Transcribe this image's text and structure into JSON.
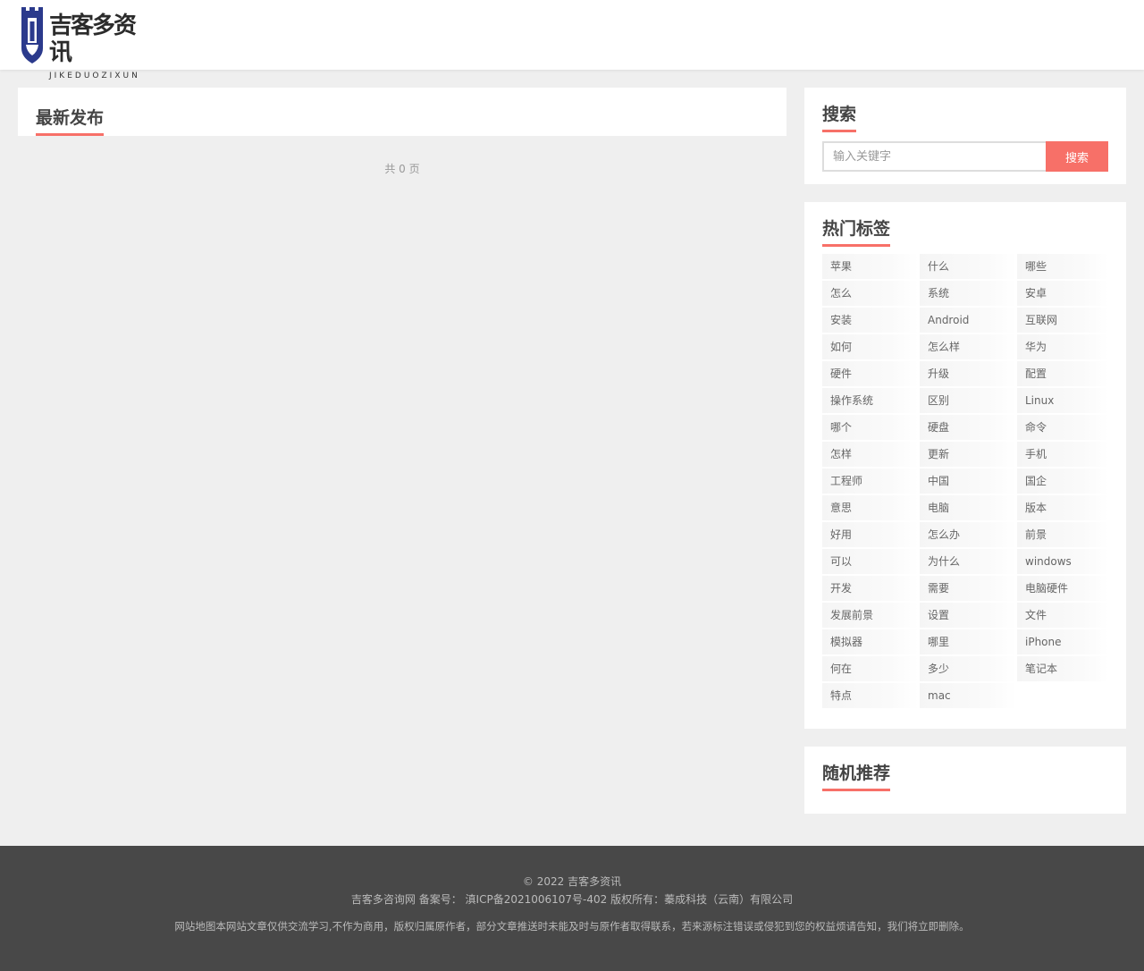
{
  "header": {
    "logo_cn": "吉客多资讯",
    "logo_en": "JIKEDUOZIXUN"
  },
  "main": {
    "section_title": "最新发布",
    "pager_text": "共 0 页"
  },
  "sidebar": {
    "search": {
      "title": "搜索",
      "placeholder": "输入关键字",
      "button_label": "搜索"
    },
    "tags": {
      "title": "热门标签",
      "items": [
        "苹果",
        "什么",
        "哪些",
        "怎么",
        "系统",
        "安卓",
        "安装",
        "Android",
        "互联网",
        "如何",
        "怎么样",
        "华为",
        "硬件",
        "升级",
        "配置",
        "操作系统",
        "区别",
        "Linux",
        "哪个",
        "硬盘",
        "命令",
        "怎样",
        "更新",
        "手机",
        "工程师",
        "中国",
        "国企",
        "意思",
        "电脑",
        "版本",
        "好用",
        "怎么办",
        "前景",
        "可以",
        "为什么",
        "windows",
        "开发",
        "需要",
        "电脑硬件",
        "发展前景",
        "设置",
        "文件",
        "模拟器",
        "哪里",
        "iPhone",
        "何在",
        "多少",
        "笔记本",
        "特点",
        "mac"
      ]
    },
    "random": {
      "title": "随机推荐"
    }
  },
  "footer": {
    "copyright": "© 2022 吉客多资讯",
    "icp": "吉客多咨询网 备案号： 滇ICP备2021006107号-402 版权所有：蓁成科技（云南）有限公司",
    "disclaimer": "网站地图本网站文章仅供交流学习,不作为商用，版权归属原作者，部分文章推送时未能及时与原作者取得联系，若来源标注错误或侵犯到您的权益烦请告知，我们将立即删除。"
  },
  "colors": {
    "accent": "#f77068",
    "logo_blue": "#2b3a8c",
    "footer_bg": "#484848"
  }
}
